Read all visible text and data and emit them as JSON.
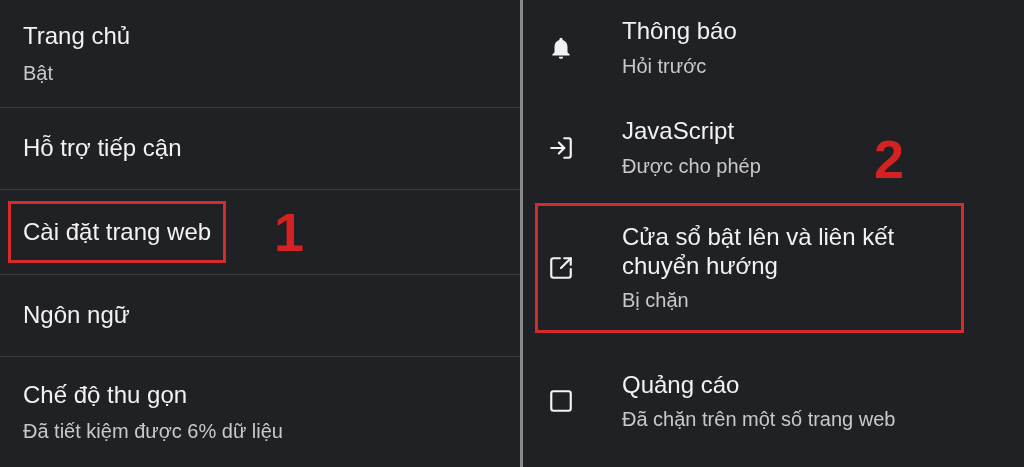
{
  "left_settings": [
    {
      "title": "Trang chủ",
      "subtitle": "Bật",
      "highlighted": false
    },
    {
      "title": "Hỗ trợ tiếp cận",
      "highlighted": false
    },
    {
      "title": "Cài đặt trang web",
      "highlighted": true,
      "callout": "1"
    },
    {
      "title": "Ngôn ngữ",
      "highlighted": false
    },
    {
      "title": "Chế độ thu gọn",
      "subtitle": "Đã tiết kiệm được 6% dữ liệu",
      "highlighted": false
    }
  ],
  "site_settings": [
    {
      "title": "Thông báo",
      "subtitle": "Hỏi trước",
      "highlighted": false
    },
    {
      "title": "JavaScript",
      "subtitle": "Được cho phép",
      "highlighted": false,
      "callout": "2"
    },
    {
      "title": "Cửa sổ bật lên và liên kết chuyển hướng",
      "subtitle": "Bị chặn",
      "highlighted": true
    },
    {
      "title": "Quảng cáo",
      "subtitle": "Đã chặn trên một số trang web",
      "highlighted": false
    }
  ]
}
